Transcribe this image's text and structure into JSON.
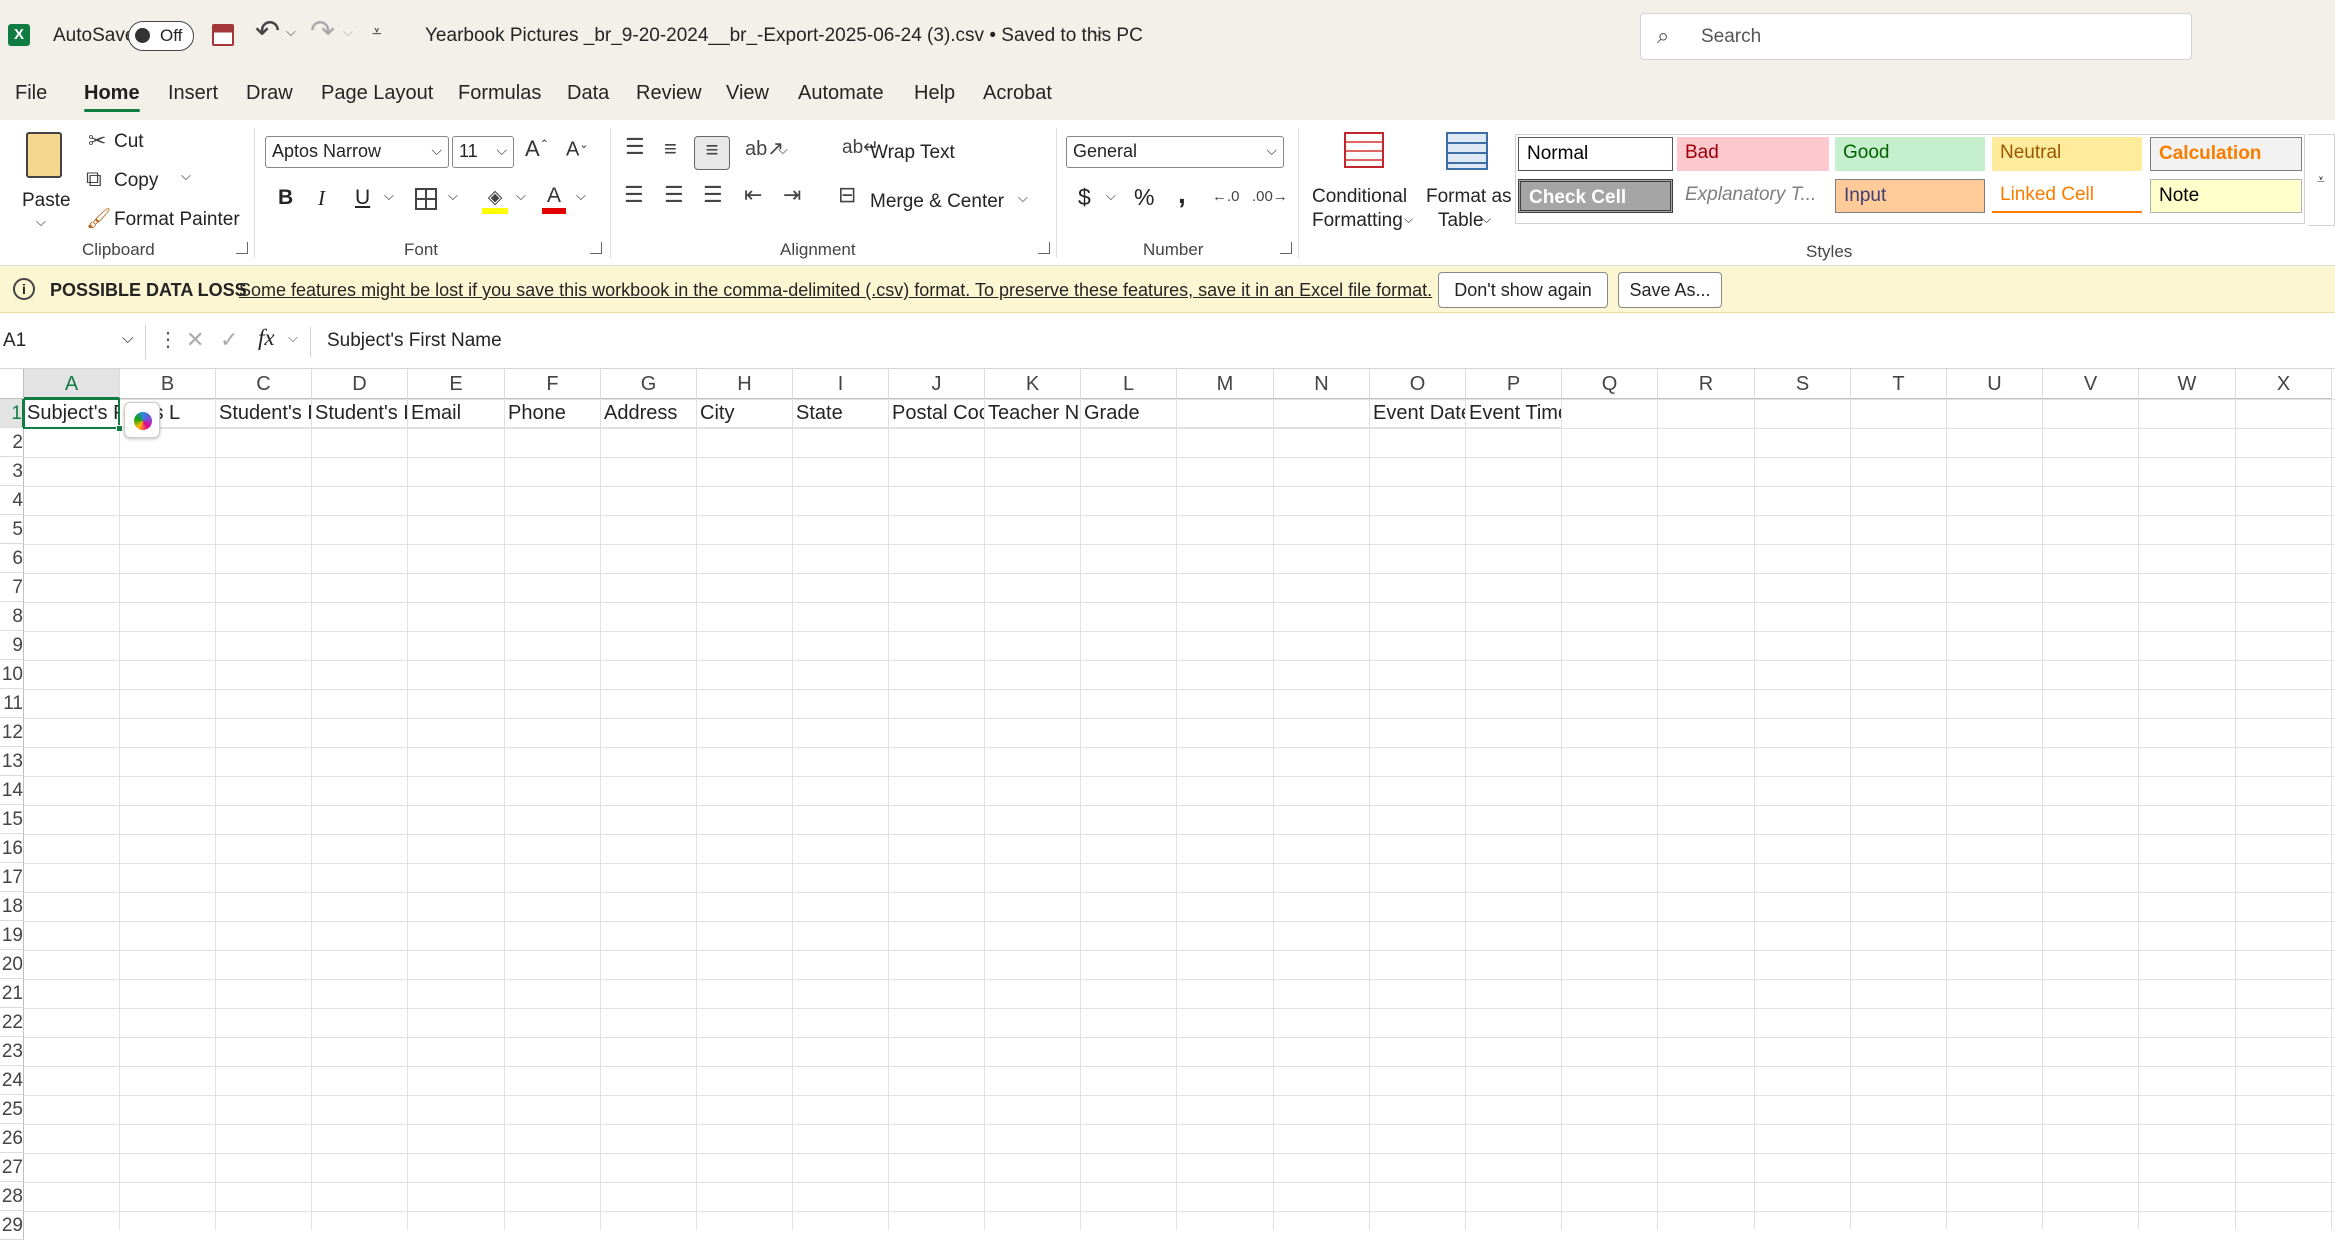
{
  "titlebar": {
    "autosave_label": "AutoSave",
    "autosave_state": "Off",
    "filename": "Yearbook Pictures _br_9-20-2024__br_-Export-2025-06-24 (3).csv • Saved to this PC",
    "search_placeholder": "Search"
  },
  "tabs": [
    "File",
    "Home",
    "Insert",
    "Draw",
    "Page Layout",
    "Formulas",
    "Data",
    "Review",
    "View",
    "Automate",
    "Help",
    "Acrobat"
  ],
  "ribbon": {
    "clipboard": {
      "paste": "Paste",
      "cut": "Cut",
      "copy": "Copy",
      "format_painter": "Format Painter",
      "label": "Clipboard"
    },
    "font": {
      "name": "Aptos Narrow",
      "size": "11",
      "label": "Font",
      "bold": "B",
      "italic": "I",
      "underline": "U"
    },
    "alignment": {
      "wrap": "Wrap Text",
      "merge": "Merge & Center",
      "label": "Alignment"
    },
    "number": {
      "format": "General",
      "label": "Number",
      "currency": "$",
      "percent": "%",
      "comma": ","
    },
    "cond": {
      "line1": "Conditional",
      "line2": "Formatting"
    },
    "fmt_table": {
      "line1": "Format as",
      "line2": "Table"
    },
    "styles": {
      "label": "Styles",
      "items": [
        "Normal",
        "Bad",
        "Good",
        "Neutral",
        "Calculation",
        "Check Cell",
        "Explanatory T...",
        "Input",
        "Linked Cell",
        "Note"
      ]
    }
  },
  "msgbar": {
    "title": "POSSIBLE DATA LOSS",
    "text": "Some features might be lost if you save this workbook in the comma-delimited (.csv) format. To preserve these features, save it in an Excel file format.",
    "dont_show": "Don't show again",
    "save_as": "Save As..."
  },
  "formula": {
    "namebox": "A1",
    "fx": "fx",
    "content": "Subject's First Name"
  },
  "grid": {
    "columns": [
      "A",
      "B",
      "C",
      "D",
      "E",
      "F",
      "G",
      "H",
      "I",
      "J",
      "K",
      "L",
      "M",
      "N",
      "O",
      "P",
      "Q",
      "R",
      "S",
      "T",
      "U",
      "V",
      "W",
      "X"
    ],
    "rows": [
      "1",
      "2",
      "3",
      "4",
      "5",
      "6",
      "7",
      "8",
      "9",
      "10",
      "11",
      "12",
      "13",
      "14",
      "15",
      "16",
      "17",
      "18",
      "19",
      "20",
      "21",
      "22",
      "23",
      "24",
      "25",
      "26",
      "27",
      "28",
      "29"
    ],
    "row1": [
      "Subject's F",
      "ect's L",
      "Student's F",
      "Student's L",
      "Email",
      "Phone",
      "Address",
      "City",
      "State",
      "Postal Coc",
      "Teacher N",
      "Grade",
      "",
      "",
      "Event Date",
      "Event Time"
    ]
  }
}
